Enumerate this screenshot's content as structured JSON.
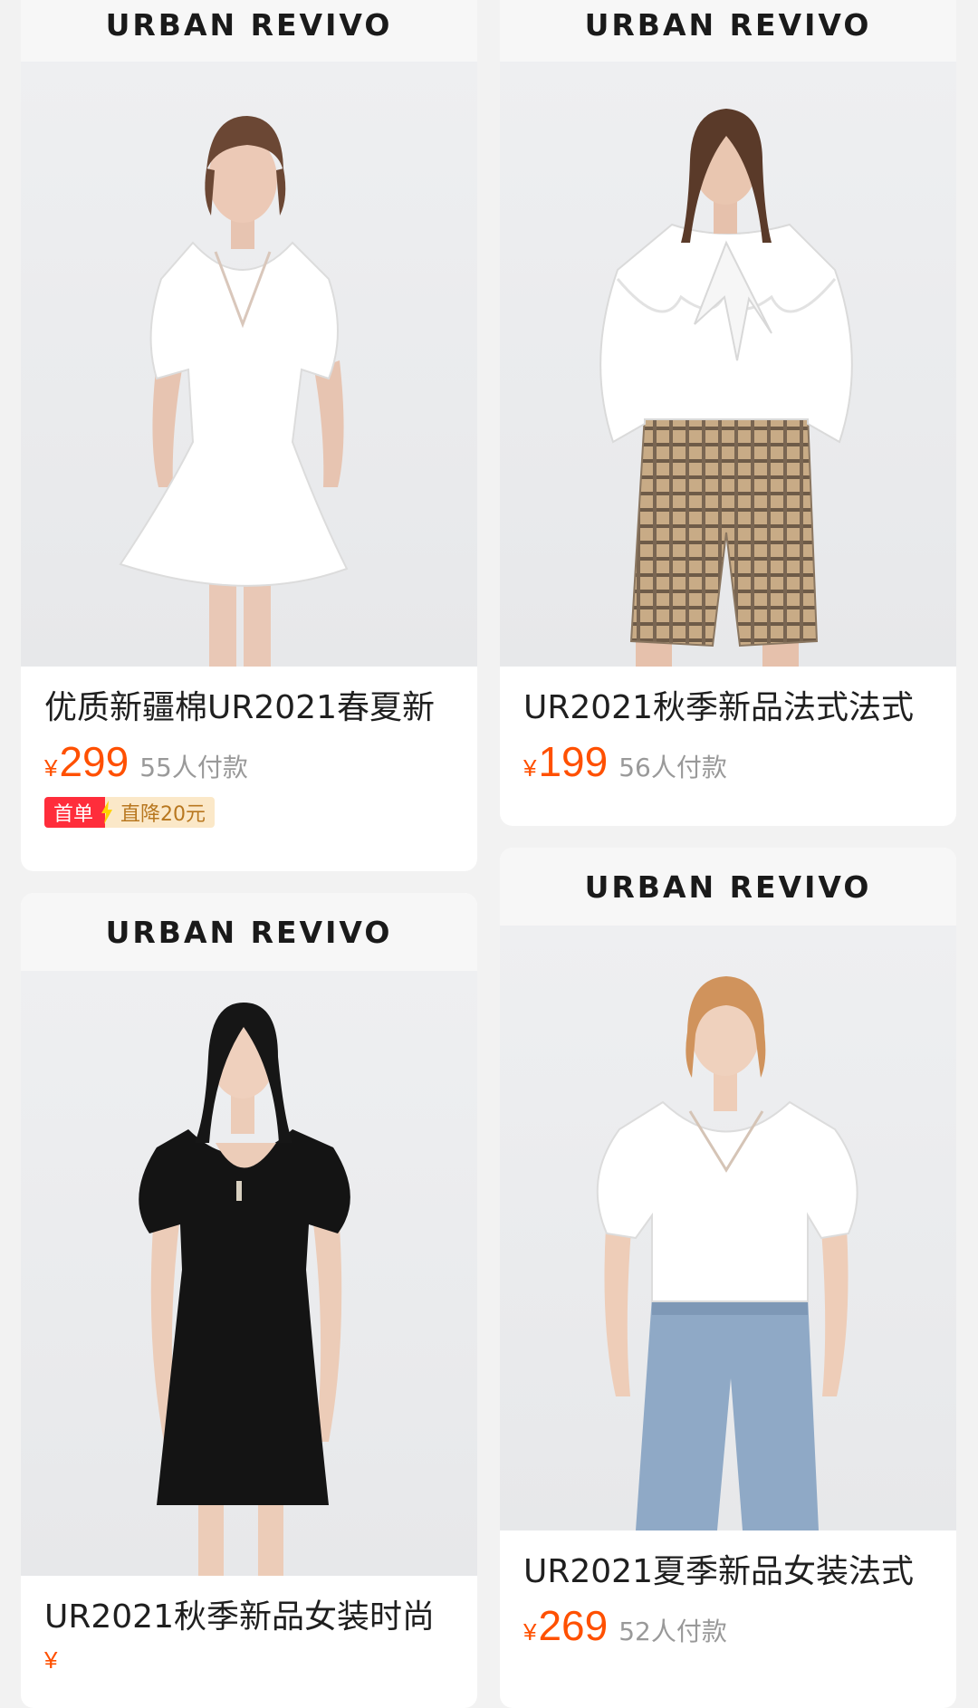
{
  "brand": "URBAN REVIVO",
  "products": [
    {
      "title": "优质新疆棉UR2021春夏新",
      "currency": "¥",
      "price": "299",
      "sold": "55人付款",
      "promo_first": "首单",
      "promo_discount": "直降20元"
    },
    {
      "title": "UR2021秋季新品法式法式",
      "currency": "¥",
      "price": "199",
      "sold": "56人付款"
    },
    {
      "title": "UR2021秋季新品女装时尚",
      "currency": "¥",
      "price": "",
      "sold": ""
    },
    {
      "title": "UR2021夏季新品女装法式",
      "currency": "¥",
      "price": "269",
      "sold": "52人付款"
    }
  ],
  "colors": {
    "price": "#ff5000",
    "promo_red": "#ff2d3b",
    "promo_gold_bg": "#fbe8c8",
    "promo_gold_text": "#b8771f"
  },
  "icons": {
    "promo_bolt": "lightning-bolt-icon"
  }
}
